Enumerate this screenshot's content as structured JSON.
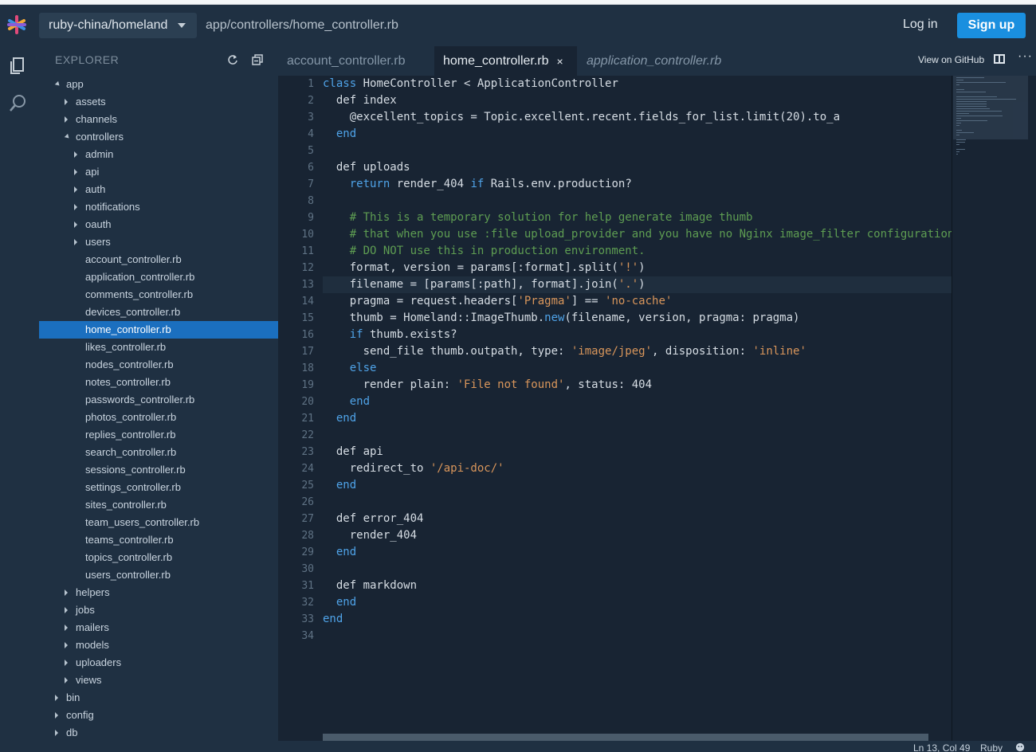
{
  "header": {
    "repo": "ruby-china/homeland",
    "path": "app/controllers/home_controller.rb",
    "login": "Log in",
    "signup": "Sign up"
  },
  "explorer": {
    "title": "EXPLORER",
    "items": [
      {
        "label": "app",
        "depth": 0,
        "type": "open"
      },
      {
        "label": "assets",
        "depth": 1,
        "type": "closed"
      },
      {
        "label": "channels",
        "depth": 1,
        "type": "closed"
      },
      {
        "label": "controllers",
        "depth": 1,
        "type": "open"
      },
      {
        "label": "admin",
        "depth": 2,
        "type": "closed"
      },
      {
        "label": "api",
        "depth": 2,
        "type": "closed"
      },
      {
        "label": "auth",
        "depth": 2,
        "type": "closed"
      },
      {
        "label": "notifications",
        "depth": 2,
        "type": "closed"
      },
      {
        "label": "oauth",
        "depth": 2,
        "type": "closed"
      },
      {
        "label": "users",
        "depth": 2,
        "type": "closed"
      },
      {
        "label": "account_controller.rb",
        "depth": 2,
        "type": "file"
      },
      {
        "label": "application_controller.rb",
        "depth": 2,
        "type": "file"
      },
      {
        "label": "comments_controller.rb",
        "depth": 2,
        "type": "file"
      },
      {
        "label": "devices_controller.rb",
        "depth": 2,
        "type": "file"
      },
      {
        "label": "home_controller.rb",
        "depth": 2,
        "type": "file",
        "selected": true
      },
      {
        "label": "likes_controller.rb",
        "depth": 2,
        "type": "file"
      },
      {
        "label": "nodes_controller.rb",
        "depth": 2,
        "type": "file"
      },
      {
        "label": "notes_controller.rb",
        "depth": 2,
        "type": "file"
      },
      {
        "label": "passwords_controller.rb",
        "depth": 2,
        "type": "file"
      },
      {
        "label": "photos_controller.rb",
        "depth": 2,
        "type": "file"
      },
      {
        "label": "replies_controller.rb",
        "depth": 2,
        "type": "file"
      },
      {
        "label": "search_controller.rb",
        "depth": 2,
        "type": "file"
      },
      {
        "label": "sessions_controller.rb",
        "depth": 2,
        "type": "file"
      },
      {
        "label": "settings_controller.rb",
        "depth": 2,
        "type": "file"
      },
      {
        "label": "sites_controller.rb",
        "depth": 2,
        "type": "file"
      },
      {
        "label": "team_users_controller.rb",
        "depth": 2,
        "type": "file"
      },
      {
        "label": "teams_controller.rb",
        "depth": 2,
        "type": "file"
      },
      {
        "label": "topics_controller.rb",
        "depth": 2,
        "type": "file"
      },
      {
        "label": "users_controller.rb",
        "depth": 2,
        "type": "file"
      },
      {
        "label": "helpers",
        "depth": 1,
        "type": "closed"
      },
      {
        "label": "jobs",
        "depth": 1,
        "type": "closed"
      },
      {
        "label": "mailers",
        "depth": 1,
        "type": "closed"
      },
      {
        "label": "models",
        "depth": 1,
        "type": "closed"
      },
      {
        "label": "uploaders",
        "depth": 1,
        "type": "closed"
      },
      {
        "label": "views",
        "depth": 1,
        "type": "closed"
      },
      {
        "label": "bin",
        "depth": 0,
        "type": "closed"
      },
      {
        "label": "config",
        "depth": 0,
        "type": "closed"
      },
      {
        "label": "db",
        "depth": 0,
        "type": "closed"
      }
    ]
  },
  "tabs": [
    {
      "label": "account_controller.rb",
      "state": "inactive"
    },
    {
      "label": "home_controller.rb",
      "state": "active",
      "close": "×"
    },
    {
      "label": "application_controller.rb",
      "state": "preview"
    }
  ],
  "toolbar": {
    "view_on_github": "View on GitHub",
    "more": "···"
  },
  "editor": {
    "current_line": 13,
    "lines": [
      [
        [
          "kw",
          "class"
        ],
        [
          "p",
          " HomeController < ApplicationController"
        ]
      ],
      [
        [
          "p",
          "  def index"
        ]
      ],
      [
        [
          "p",
          "    @excellent_topics = Topic.excellent.recent.fields_for_list.limit(20).to_a"
        ]
      ],
      [
        [
          "kw",
          "  end"
        ]
      ],
      [],
      [
        [
          "p",
          "  def uploads"
        ]
      ],
      [
        [
          "kw",
          "    return"
        ],
        [
          "p",
          " render_404 "
        ],
        [
          "kw",
          "if"
        ],
        [
          "p",
          " Rails.env.production?"
        ]
      ],
      [],
      [
        [
          "cm",
          "    # This is a temporary solution for help generate image thumb"
        ]
      ],
      [
        [
          "cm",
          "    # that when you use :file upload_provider and you have no Nginx image_filter configuration"
        ]
      ],
      [
        [
          "cm",
          "    # DO NOT use this in production environment."
        ]
      ],
      [
        [
          "p",
          "    format, version = params[:format].split("
        ],
        [
          "st",
          "'!'"
        ],
        [
          "p",
          ")"
        ]
      ],
      [
        [
          "p",
          "    filename = [params[:path], format].join("
        ],
        [
          "st",
          "'.'"
        ],
        [
          "p",
          ")"
        ]
      ],
      [
        [
          "p",
          "    pragma = request.headers["
        ],
        [
          "st",
          "'Pragma'"
        ],
        [
          "p",
          "] == "
        ],
        [
          "st",
          "'no-cache'"
        ]
      ],
      [
        [
          "p",
          "    thumb = Homeland::ImageThumb."
        ],
        [
          "kw",
          "new"
        ],
        [
          "p",
          "(filename, version, pragma: pragma)"
        ]
      ],
      [
        [
          "kw",
          "    if"
        ],
        [
          "p",
          " thumb.exists?"
        ]
      ],
      [
        [
          "p",
          "      send_file thumb.outpath, type: "
        ],
        [
          "st",
          "'image/jpeg'"
        ],
        [
          "p",
          ", disposition: "
        ],
        [
          "st",
          "'inline'"
        ]
      ],
      [
        [
          "kw",
          "    else"
        ]
      ],
      [
        [
          "p",
          "      render plain: "
        ],
        [
          "st",
          "'File not found'"
        ],
        [
          "p",
          ", status: 404"
        ]
      ],
      [
        [
          "kw",
          "    end"
        ]
      ],
      [
        [
          "kw",
          "  end"
        ]
      ],
      [],
      [
        [
          "p",
          "  def api"
        ]
      ],
      [
        [
          "p",
          "    redirect_to "
        ],
        [
          "st",
          "'/api-doc/'"
        ]
      ],
      [
        [
          "kw",
          "  end"
        ]
      ],
      [],
      [
        [
          "p",
          "  def error_404"
        ]
      ],
      [
        [
          "p",
          "    render_404"
        ]
      ],
      [
        [
          "kw",
          "  end"
        ]
      ],
      [],
      [
        [
          "p",
          "  def markdown"
        ]
      ],
      [
        [
          "kw",
          "  end"
        ]
      ],
      [
        [
          "kw",
          "end"
        ]
      ],
      []
    ]
  },
  "status": {
    "position": "Ln 13, Col 49",
    "language": "Ruby"
  }
}
